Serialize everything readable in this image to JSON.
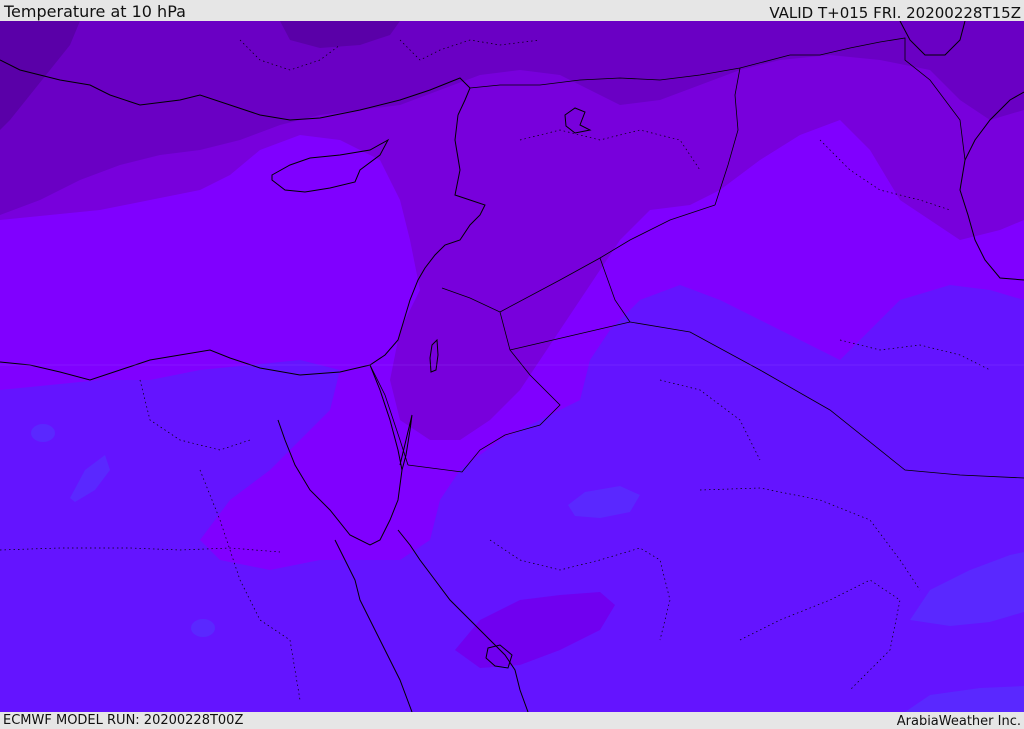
{
  "header": {
    "title": "Temperature at 10 hPa",
    "valid_time": "VALID T+015 FRI. 20200228T15Z"
  },
  "footer": {
    "model_run": "ECMWF MODEL RUN: 20200228T00Z",
    "credit": "ArabiaWeather Inc."
  },
  "map": {
    "region": "Eastern Mediterranean / Middle East",
    "field": "temperature",
    "colors": {
      "darkest": "#5a00a8",
      "dark": "#6a00c4",
      "mid_dark": "#7800dc",
      "violet": "#8000ff",
      "blue_violet": "#6414ff",
      "blue": "#5a28ff",
      "coastline": "#000000"
    }
  }
}
